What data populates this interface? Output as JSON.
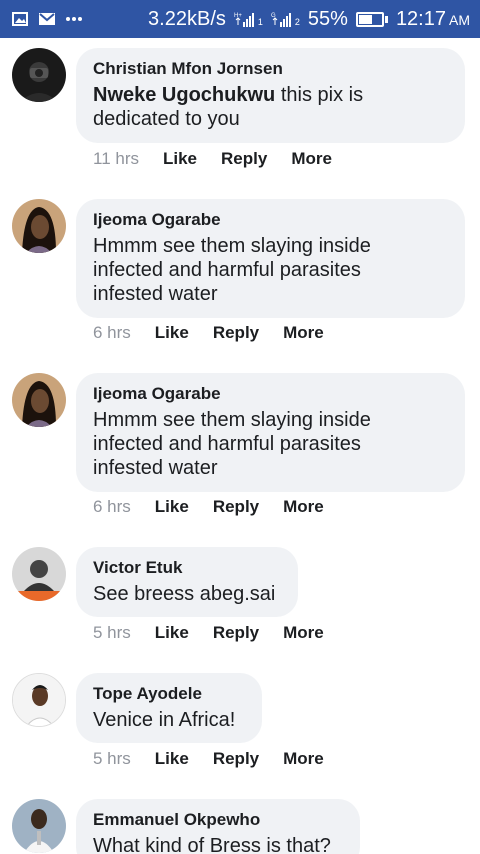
{
  "status_bar": {
    "speed": "3.22kB/s",
    "battery_pct": "55%",
    "time": "12:17",
    "ampm": "AM",
    "sim1": "1",
    "sim2": "2"
  },
  "comments": [
    {
      "author": "Christian Mfon Jornsen",
      "tag": "Nweke Ugochukwu",
      "text_line1": " this pix is",
      "text_line2": "dedicated to you",
      "time": "11 hrs",
      "like": "Like",
      "reply": "Reply",
      "more": "More"
    },
    {
      "author": "Ijeoma Ogarabe",
      "text_line1": "Hmmm see them slaying inside",
      "text_line2": "infected and harmful parasites",
      "text_line3": "infested water",
      "time": "6 hrs",
      "like": "Like",
      "reply": "Reply",
      "more": "More"
    },
    {
      "author": "Ijeoma Ogarabe",
      "text_line1": "Hmmm see them slaying inside",
      "text_line2": "infected and harmful parasites",
      "text_line3": "infested water",
      "time": "6 hrs",
      "like": "Like",
      "reply": "Reply",
      "more": "More"
    },
    {
      "author": "Victor Etuk",
      "text_line1": "See breess abeg.sai",
      "time": "5 hrs",
      "like": "Like",
      "reply": "Reply",
      "more": "More"
    },
    {
      "author": "Tope Ayodele",
      "text_line1": "Venice in Africa!",
      "time": "5 hrs",
      "like": "Like",
      "reply": "Reply",
      "more": "More"
    },
    {
      "author": "Emmanuel Okpewho",
      "text_line1": "What kind of Bress is that?"
    }
  ]
}
